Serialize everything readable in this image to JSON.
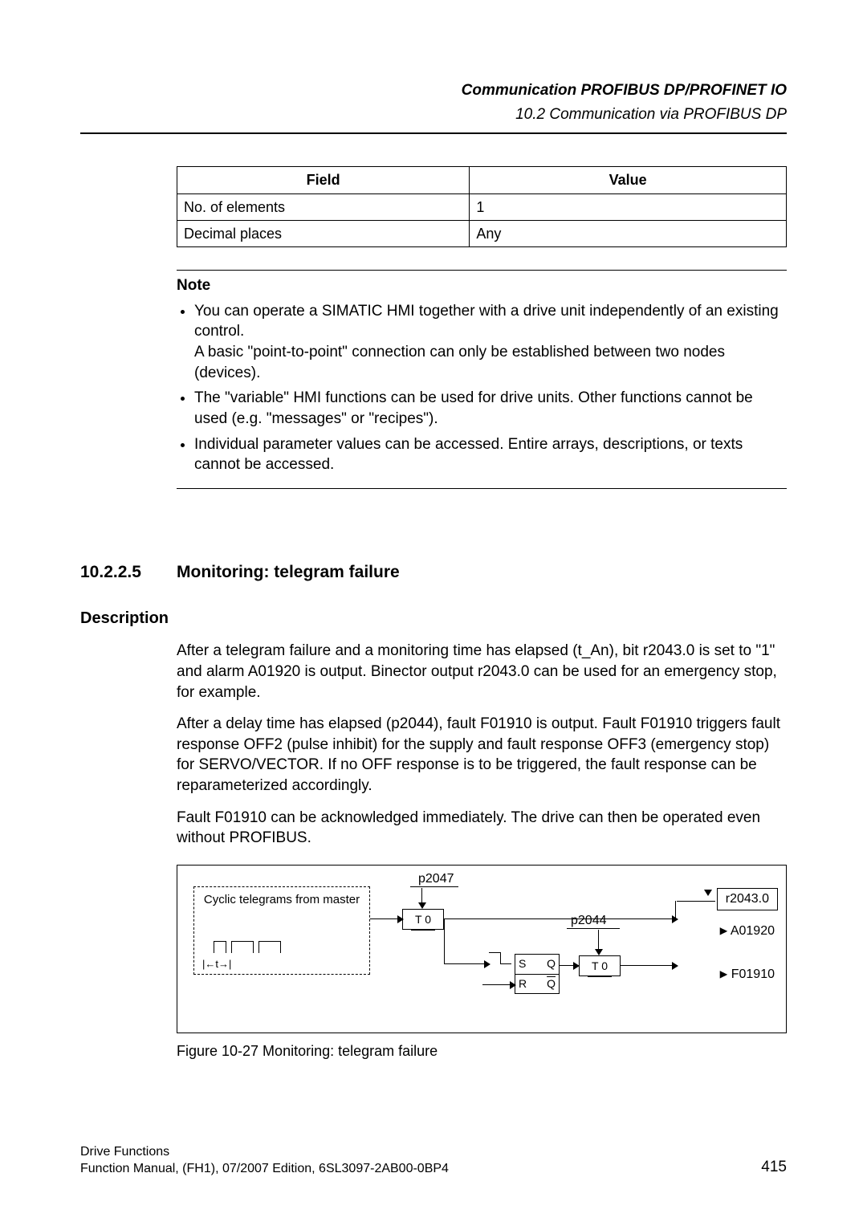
{
  "header": {
    "line1": "Communication PROFIBUS DP/PROFINET IO",
    "line2": "10.2 Communication via PROFIBUS DP"
  },
  "field_value_table": {
    "head_field": "Field",
    "head_value": "Value",
    "rows": [
      {
        "field": "No. of elements",
        "value": "1"
      },
      {
        "field": "Decimal places",
        "value": "Any"
      }
    ]
  },
  "note": {
    "heading": "Note",
    "items": [
      {
        "p1": "You can operate a SIMATIC HMI together with a drive unit independently of an existing control.",
        "p2": "A basic \"point-to-point\" connection can only be established between two nodes (devices)."
      },
      {
        "p1": "The \"variable\" HMI functions can be used for drive units. Other functions cannot be used (e.g. \"messages\" or \"recipes\")."
      },
      {
        "p1": "Individual parameter values can be accessed. Entire arrays, descriptions, or texts cannot be accessed."
      }
    ]
  },
  "section": {
    "number": "10.2.2.5",
    "title": "Monitoring: telegram failure"
  },
  "description": {
    "heading": "Description",
    "paras": [
      "After a telegram failure and a monitoring time has elapsed (t_An), bit r2043.0 is set to \"1\" and alarm A01920 is output. Binector output r2043.0 can be used for an emergency stop, for example.",
      "After a delay time has elapsed (p2044), fault F01910 is output. Fault F01910 triggers fault response OFF2 (pulse inhibit) for the supply and fault response OFF3 (emergency stop) for SERVO/VECTOR. If no OFF response is to be triggered, the fault response can be reparameterized accordingly.",
      "Fault F01910 can be acknowledged immediately. The drive can then be operated even without PROFIBUS."
    ]
  },
  "figure": {
    "caption": "Figure 10-27   Monitoring: telegram failure",
    "labels": {
      "cyclic": "Cyclic telegrams from master",
      "p2047": "p2047",
      "p2044": "p2044",
      "r2043": "r2043.0",
      "a01920": "A01920",
      "f01910": "F01910",
      "T0": "T   0",
      "t": "t",
      "S": "S",
      "Q": "Q",
      "R": "R",
      "Qbar": "Q"
    }
  },
  "footer": {
    "line1": "Drive Functions",
    "line2": "Function Manual, (FH1), 07/2007 Edition, 6SL3097-2AB00-0BP4",
    "page": "415"
  }
}
